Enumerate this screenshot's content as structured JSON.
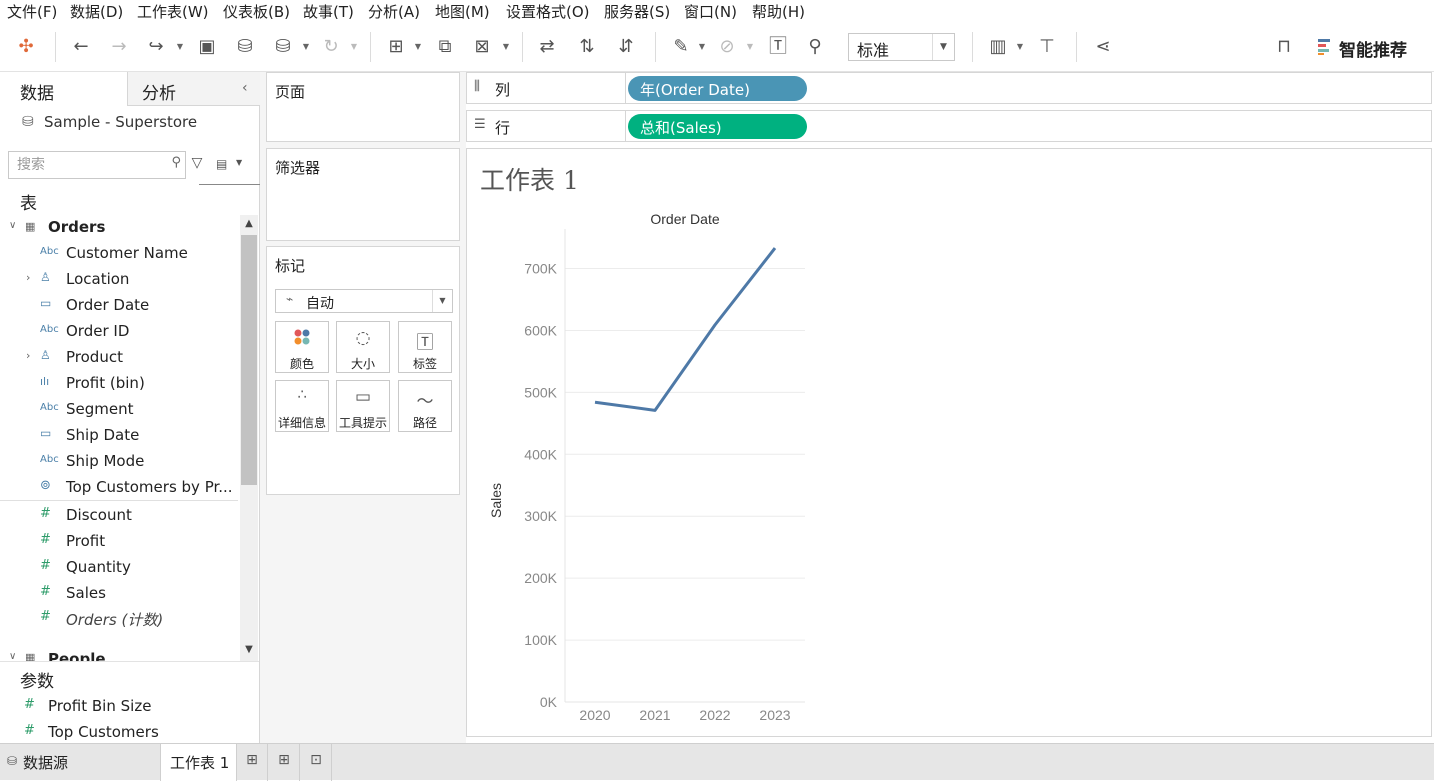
{
  "menu": [
    "文件(F)",
    "数据(D)",
    "工作表(W)",
    "仪表板(B)",
    "故事(T)",
    "分析(A)",
    "地图(M)",
    "设置格式(O)",
    "服务器(S)",
    "窗口(N)",
    "帮助(H)"
  ],
  "toolbar": {
    "fit_value": "标准",
    "smart_recommend": "智能推荐"
  },
  "data_pane": {
    "tab_data": "数据",
    "tab_analysis": "分析",
    "datasource": "Sample - Superstore",
    "search_placeholder": "搜索",
    "tables_header": "表",
    "orders_table": "Orders",
    "orders_fields": [
      {
        "label": "Customer Name",
        "type": "Abc"
      },
      {
        "label": "Location",
        "type": "hier"
      },
      {
        "label": "Order Date",
        "type": "date"
      },
      {
        "label": "Order ID",
        "type": "Abc"
      },
      {
        "label": "Product",
        "type": "hier"
      },
      {
        "label": "Profit (bin)",
        "type": "bin"
      },
      {
        "label": "Segment",
        "type": "Abc"
      },
      {
        "label": "Ship Date",
        "type": "date"
      },
      {
        "label": "Ship Mode",
        "type": "Abc"
      },
      {
        "label": "Top Customers by Pr...",
        "type": "set"
      }
    ],
    "orders_measures": [
      "Discount",
      "Profit",
      "Quantity",
      "Sales",
      "Orders (计数)"
    ],
    "people_table": "People",
    "params_header": "参数",
    "params": [
      "Profit Bin Size",
      "Top Customers"
    ]
  },
  "cards": {
    "pages": "页面",
    "filters": "筛选器",
    "marks": "标记",
    "marks_type": "自动",
    "mark_buttons": [
      "颜色",
      "大小",
      "标签",
      "详细信息",
      "工具提示",
      "路径"
    ]
  },
  "shelves": {
    "columns_label": "列",
    "rows_label": "行",
    "columns_pill": "年(Order Date)",
    "rows_pill": "总和(Sales)"
  },
  "sheet_title": "工作表 1",
  "chart_data": {
    "type": "line",
    "title": "Order Date",
    "ylabel": "Sales",
    "categories": [
      "2020",
      "2021",
      "2022",
      "2023"
    ],
    "values": [
      484000,
      471000,
      609000,
      733000
    ],
    "ylim": [
      0,
      780000
    ],
    "yticks": [
      0,
      100000,
      200000,
      300000,
      400000,
      500000,
      600000,
      700000
    ],
    "ytick_labels": [
      "0K",
      "100K",
      "200K",
      "300K",
      "400K",
      "500K",
      "600K",
      "700K"
    ],
    "line_color": "#4e79a7",
    "grid": true
  },
  "bottom_tabs": {
    "datasource": "数据源",
    "sheet": "工作表 1"
  }
}
